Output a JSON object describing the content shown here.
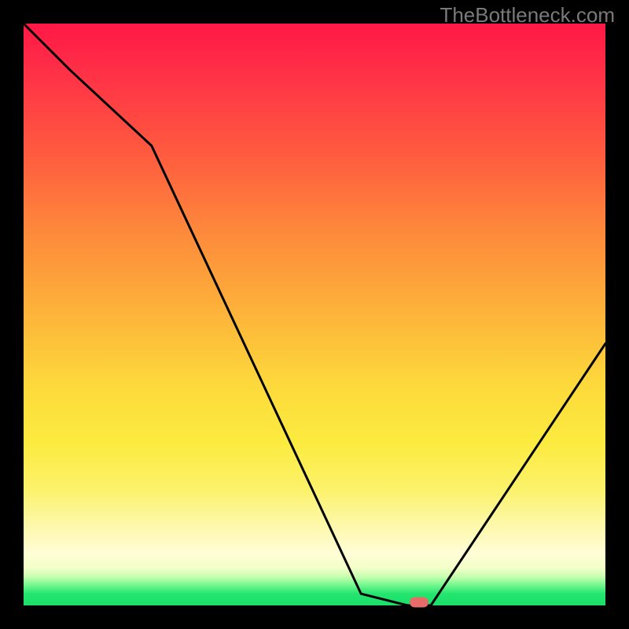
{
  "watermark": "TheBottleneck.com",
  "colors": {
    "background": "#000000",
    "gradient_top": "#ff1846",
    "gradient_mid": "#fceb3f",
    "gradient_bottom": "#1adf68",
    "curve": "#000000",
    "marker": "#e76b69"
  },
  "chart_data": {
    "type": "line",
    "title": "",
    "xlabel": "",
    "ylabel": "",
    "x_range": [
      0,
      100
    ],
    "y_range": [
      0,
      100
    ],
    "curve": {
      "name": "bottleneck-curve",
      "x": [
        0,
        8,
        22,
        58,
        66,
        70,
        100
      ],
      "y": [
        100,
        92,
        79,
        2,
        0,
        0,
        45
      ]
    },
    "marker": {
      "x": 68,
      "y": 0.5
    },
    "annotations": []
  }
}
